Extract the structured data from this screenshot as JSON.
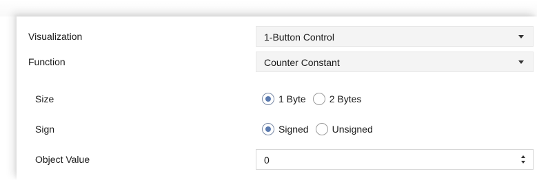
{
  "visualization": {
    "label": "Visualization",
    "value": "1-Button Control"
  },
  "function": {
    "label": "Function",
    "value": "Counter Constant"
  },
  "size": {
    "label": "Size",
    "options": [
      {
        "label": "1 Byte",
        "checked": true
      },
      {
        "label": "2 Bytes",
        "checked": false
      }
    ]
  },
  "sign": {
    "label": "Sign",
    "options": [
      {
        "label": "Signed",
        "checked": true
      },
      {
        "label": "Unsigned",
        "checked": false
      }
    ]
  },
  "object_value": {
    "label": "Object Value",
    "value": "0"
  },
  "colors": {
    "accent": "#5b7bb0",
    "field_bg": "#f4f4f4"
  }
}
